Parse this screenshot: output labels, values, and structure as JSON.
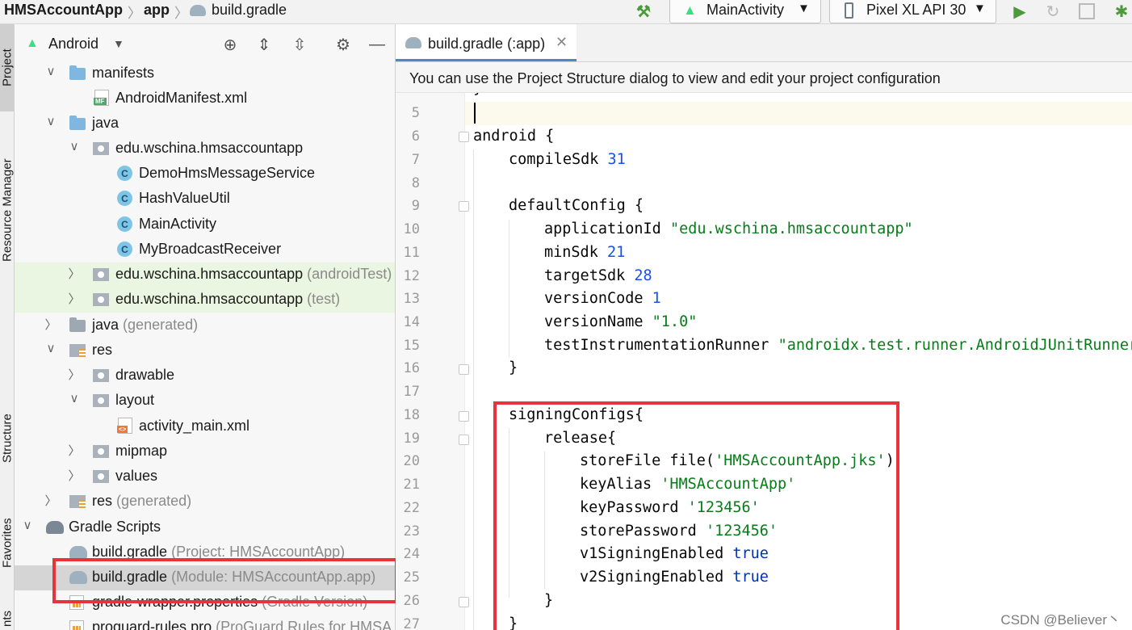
{
  "breadcrumb": {
    "project": "HMSAccountApp",
    "module": "app",
    "file": "build.gradle"
  },
  "toolbar": {
    "run_config": "MainActivity",
    "device": "Pixel XL API 30"
  },
  "tool_strip": {
    "project": "Project",
    "resource_manager": "Resource Manager",
    "structure": "Structure",
    "favorites": "Favorites",
    "build_variants": "nts"
  },
  "project_panel": {
    "view_mode": "Android",
    "tree": [
      {
        "label": "manifests",
        "suffix": ""
      },
      {
        "label": "AndroidManifest.xml",
        "suffix": ""
      },
      {
        "label": "java",
        "suffix": ""
      },
      {
        "label": "edu.wschina.hmsaccountapp",
        "suffix": ""
      },
      {
        "label": "DemoHmsMessageService",
        "suffix": ""
      },
      {
        "label": "HashValueUtil",
        "suffix": ""
      },
      {
        "label": "MainActivity",
        "suffix": ""
      },
      {
        "label": "MyBroadcastReceiver",
        "suffix": ""
      },
      {
        "label": "edu.wschina.hmsaccountapp",
        "suffix": "(androidTest)"
      },
      {
        "label": "edu.wschina.hmsaccountapp",
        "suffix": "(test)"
      },
      {
        "label": "java",
        "suffix": "(generated)"
      },
      {
        "label": "res",
        "suffix": ""
      },
      {
        "label": "drawable",
        "suffix": ""
      },
      {
        "label": "layout",
        "suffix": ""
      },
      {
        "label": "activity_main.xml",
        "suffix": ""
      },
      {
        "label": "mipmap",
        "suffix": ""
      },
      {
        "label": "values",
        "suffix": ""
      },
      {
        "label": "res",
        "suffix": "(generated)"
      },
      {
        "label": "Gradle Scripts",
        "suffix": ""
      },
      {
        "label": "build.gradle",
        "suffix": "(Project: HMSAccountApp)"
      },
      {
        "label": "build.gradle",
        "suffix": "(Module: HMSAccountApp.app)"
      },
      {
        "label": "gradle-wrapper.properties",
        "suffix": "(Gradle Version)"
      },
      {
        "label": "proguard-rules.pro",
        "suffix": "(ProGuard Rules for HMSA"
      }
    ]
  },
  "editor": {
    "tab_label": "build.gradle (:app)",
    "banner": "You can use the Project Structure dialog to view and edit your project configuration",
    "lines": [
      {
        "n": "5"
      },
      {
        "n": "6",
        "t": [
          "android {"
        ]
      },
      {
        "n": "7",
        "t": [
          "compileSdk ",
          "31"
        ]
      },
      {
        "n": "8"
      },
      {
        "n": "9",
        "t": [
          "defaultConfig {"
        ]
      },
      {
        "n": "10",
        "t": [
          "applicationId ",
          "\"edu.wschina.hmsaccountapp\""
        ]
      },
      {
        "n": "11",
        "t": [
          "minSdk ",
          "21"
        ]
      },
      {
        "n": "12",
        "t": [
          "targetSdk ",
          "28"
        ]
      },
      {
        "n": "13",
        "t": [
          "versionCode ",
          "1"
        ]
      },
      {
        "n": "14",
        "t": [
          "versionName ",
          "\"1.0\""
        ]
      },
      {
        "n": "15",
        "t": [
          "testInstrumentationRunner ",
          "\"androidx.test.runner.AndroidJUnitRunner\""
        ]
      },
      {
        "n": "16",
        "t": [
          "}"
        ]
      },
      {
        "n": "17"
      },
      {
        "n": "18",
        "t": [
          "signingConfigs{"
        ]
      },
      {
        "n": "19",
        "t": [
          "release{"
        ]
      },
      {
        "n": "20",
        "t": [
          "storeFile file(",
          "'HMSAccountApp.jks'",
          ")"
        ]
      },
      {
        "n": "21",
        "t": [
          "keyAlias ",
          "'HMSAccountApp'"
        ]
      },
      {
        "n": "22",
        "t": [
          "keyPassword ",
          "'123456'"
        ]
      },
      {
        "n": "23",
        "t": [
          "storePassword ",
          "'123456'"
        ]
      },
      {
        "n": "24",
        "t": [
          "v1SigningEnabled ",
          "true"
        ]
      },
      {
        "n": "25",
        "t": [
          "v2SigningEnabled ",
          "true"
        ]
      },
      {
        "n": "26",
        "t": [
          "}"
        ]
      },
      {
        "n": "27",
        "t": [
          "}"
        ]
      }
    ]
  },
  "colors": {
    "highlight_box": "#e8323c",
    "test_source_bg": "#eaf6e2",
    "selection_bg": "#d5d5d5",
    "string": "#067d17",
    "number": "#1750eb",
    "keyword": "#0033b3"
  },
  "watermark": "CSDN @Believer丶"
}
